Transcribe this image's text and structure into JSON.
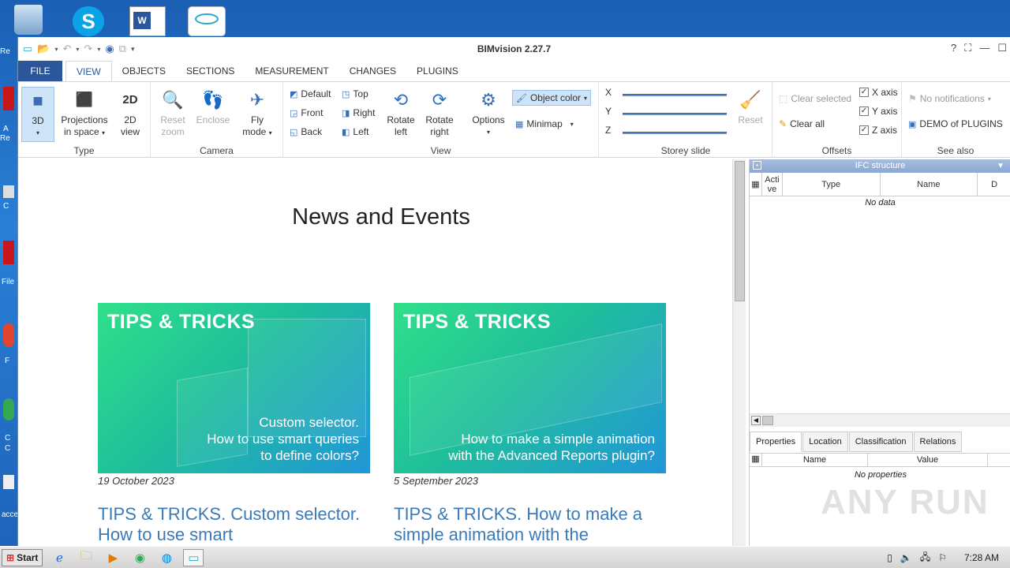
{
  "desktop": {
    "icons": [
      {
        "label": "Re",
        "icon": "recycle-bin-icon"
      },
      {
        "label": "",
        "icon": "skype-icon"
      },
      {
        "label": "",
        "icon": "word-icon"
      },
      {
        "label": "",
        "icon": "bimvision-icon"
      }
    ],
    "side_labels": [
      "A",
      "Re",
      "C",
      "File",
      "F",
      "C",
      "C",
      "acce"
    ]
  },
  "window": {
    "title": "BIMvision 2.27.7",
    "help": "?"
  },
  "tabs": [
    "FILE",
    "VIEW",
    "OBJECTS",
    "SECTIONS",
    "MEASUREMENT",
    "CHANGES",
    "PLUGINS"
  ],
  "active_tab": "VIEW",
  "ribbon": {
    "type": {
      "label": "Type",
      "btn_3d": "3D",
      "btn_proj1": "Projections",
      "btn_proj2": "in space",
      "btn_2d_1": "2D",
      "btn_2d_2": "view"
    },
    "camera": {
      "label": "Camera",
      "reset1": "Reset",
      "reset2": "zoom",
      "enclose": "Enclose",
      "fly1": "Fly",
      "fly2": "mode"
    },
    "view": {
      "label": "View",
      "default": "Default",
      "top": "Top",
      "front": "Front",
      "right": "Right",
      "back": "Back",
      "left": "Left",
      "rotl1": "Rotate",
      "rotl2": "left",
      "rotr1": "Rotate",
      "rotr2": "right",
      "options": "Options",
      "object_color": "Object color",
      "minimap": "Minimap"
    },
    "storey": {
      "label": "Storey slide",
      "x": "X",
      "y": "Y",
      "z": "Z",
      "reset": "Reset"
    },
    "offsets": {
      "label": "Offsets",
      "clear_selected": "Clear selected",
      "clear_all": "Clear all",
      "x_axis": "X axis",
      "y_axis": "Y axis",
      "z_axis": "Z axis",
      "check": "✓"
    },
    "seealso": {
      "label": "See also",
      "notifications": "No notifications",
      "demo": "DEMO of PLUGINS"
    }
  },
  "content": {
    "heading": "News and Events",
    "cards": [
      {
        "banner": "TIPS & TRICKS",
        "caption1": "Custom selector.",
        "caption2": "How to use smart queries",
        "caption3": "to define colors?",
        "date": "19 October 2023",
        "headline": "TIPS & TRICKS. Custom selector. How to use smart"
      },
      {
        "banner": "TIPS & TRICKS",
        "caption1": "",
        "caption2": "How to make a simple animation",
        "caption3": "with the Advanced Reports plugin?",
        "date": "5 September 2023",
        "headline": "TIPS & TRICKS. How to make a simple animation with the"
      }
    ]
  },
  "ifc_panel": {
    "title": "IFC structure",
    "columns": [
      "Acti ve",
      "Type",
      "Name",
      "D"
    ],
    "empty": "No data"
  },
  "props_panel": {
    "tabs": [
      "Properties",
      "Location",
      "Classification",
      "Relations"
    ],
    "columns": [
      "Name",
      "Value"
    ],
    "empty": "No properties"
  },
  "taskbar": {
    "start": "Start",
    "clock": "7:28 AM"
  },
  "watermark": "ANY RUN",
  "colors": {
    "accent": "#2b579a",
    "link": "#3a7ab8",
    "banner_start": "#2fe08a",
    "banner_end": "#2196d9"
  }
}
